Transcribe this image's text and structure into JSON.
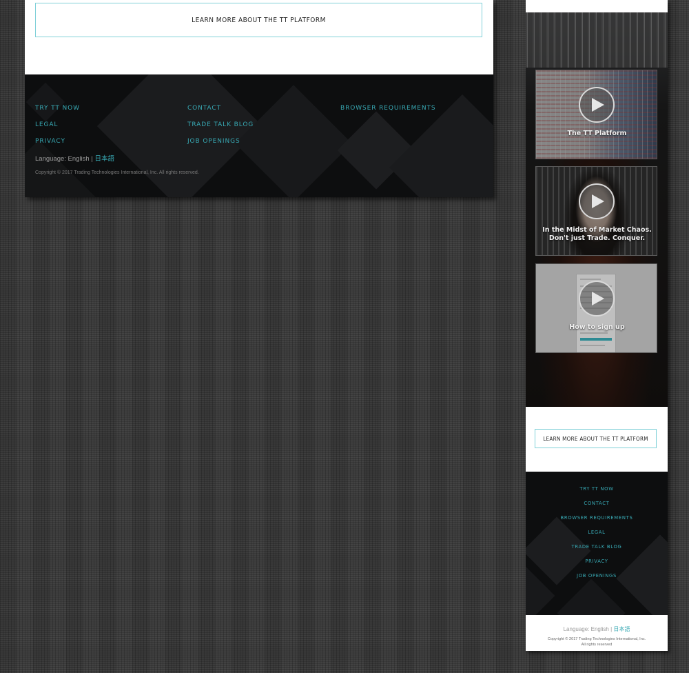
{
  "desktop": {
    "learn_more": "LEARN MORE ABOUT THE TT PLATFORM",
    "footer_links": {
      "col1": [
        "TRY TT NOW",
        "LEGAL",
        "PRIVACY"
      ],
      "col2": [
        "CONTACT",
        "TRADE TALK BLOG",
        "JOB OPENINGS"
      ],
      "col3": [
        "BROWSER REQUIREMENTS"
      ]
    },
    "language_label": "Language: English |",
    "language_alt": "日本語",
    "copyright": "Copyright © 2017 Trading Technologies International, Inc. All rights reserved."
  },
  "mobile": {
    "videos": [
      {
        "title": "The TT Platform",
        "icon": "play-icon"
      },
      {
        "title_line1": "In the Midst of Market Chaos.",
        "title_line2": "Don't just Trade. Conquer.",
        "icon": "play-icon"
      },
      {
        "title": "How to sign up",
        "icon": "play-icon"
      }
    ],
    "learn_more": "LEARN MORE ABOUT THE TT PLATFORM",
    "footer_links": [
      "TRY TT NOW",
      "CONTACT",
      "BROWSER REQUIREMENTS",
      "LEGAL",
      "TRADE TALK BLOG",
      "PRIVACY",
      "JOB OPENINGS"
    ],
    "language_label": "Language: English |",
    "language_alt": "日本語",
    "copyright_line1": "Copyright © 2017 Trading Technologies International, Inc.",
    "copyright_line2": "All rights reserved"
  },
  "colors": {
    "accent": "#38a9b4",
    "footer_bg": "#0d0e0f",
    "button_border": "#7fd0d8"
  }
}
